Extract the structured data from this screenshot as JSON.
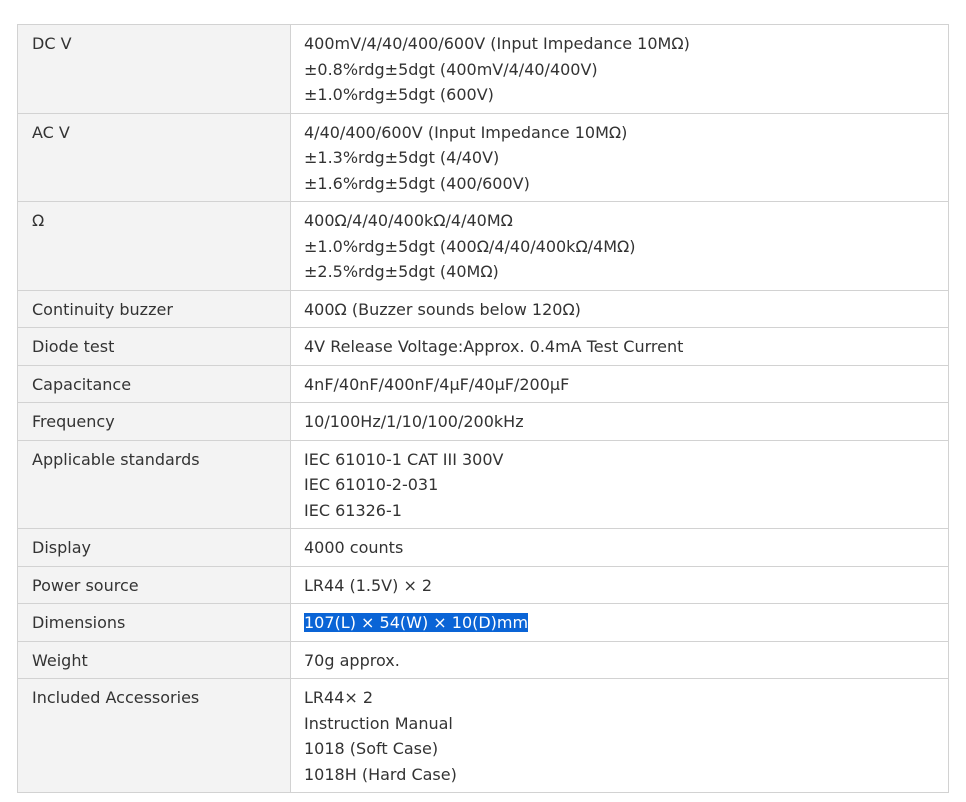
{
  "specs": [
    {
      "label": "DC V",
      "lines": [
        "400mV/4/40/400/600V (Input Impedance 10MΩ)",
        "±0.8%rdg±5dgt (400mV/4/40/400V)",
        "±1.0%rdg±5dgt (600V)"
      ]
    },
    {
      "label": "AC V",
      "lines": [
        "4/40/400/600V (Input Impedance 10MΩ)",
        "±1.3%rdg±5dgt (4/40V)",
        "±1.6%rdg±5dgt (400/600V)"
      ]
    },
    {
      "label": "Ω",
      "lines": [
        "400Ω/4/40/400kΩ/4/40MΩ",
        "±1.0%rdg±5dgt (400Ω/4/40/400kΩ/4MΩ)",
        "±2.5%rdg±5dgt (40MΩ)"
      ]
    },
    {
      "label": "Continuity buzzer",
      "lines": [
        "400Ω (Buzzer sounds below 120Ω)"
      ]
    },
    {
      "label": "Diode test",
      "lines": [
        "4V Release Voltage:Approx. 0.4mA Test Current"
      ]
    },
    {
      "label": "Capacitance",
      "lines": [
        "4nF/40nF/400nF/4μF/40μF/200μF"
      ]
    },
    {
      "label": "Frequency",
      "lines": [
        "10/100Hz/1/10/100/200kHz"
      ]
    },
    {
      "label": "Applicable standards",
      "lines": [
        "IEC 61010-1 CAT III 300V",
        "IEC 61010-2-031",
        "IEC 61326-1"
      ]
    },
    {
      "label": "Display",
      "lines": [
        "4000 counts"
      ]
    },
    {
      "label": "Power source",
      "lines": [
        "LR44 (1.5V) × 2"
      ]
    },
    {
      "label": "Dimensions",
      "lines": [
        "107(L) × 54(W) × 10(D)mm"
      ],
      "selected": true
    },
    {
      "label": "Weight",
      "lines": [
        "70g approx."
      ]
    },
    {
      "label": "Included Accessories",
      "lines": [
        "LR44× 2",
        "Instruction Manual",
        "1018 (Soft Case)",
        "1018H (Hard Case)"
      ]
    }
  ],
  "colors": {
    "label_background": "#f3f3f3",
    "border": "#d2d2d2",
    "text": "#333333",
    "selection_highlight": "#0a64d6"
  }
}
